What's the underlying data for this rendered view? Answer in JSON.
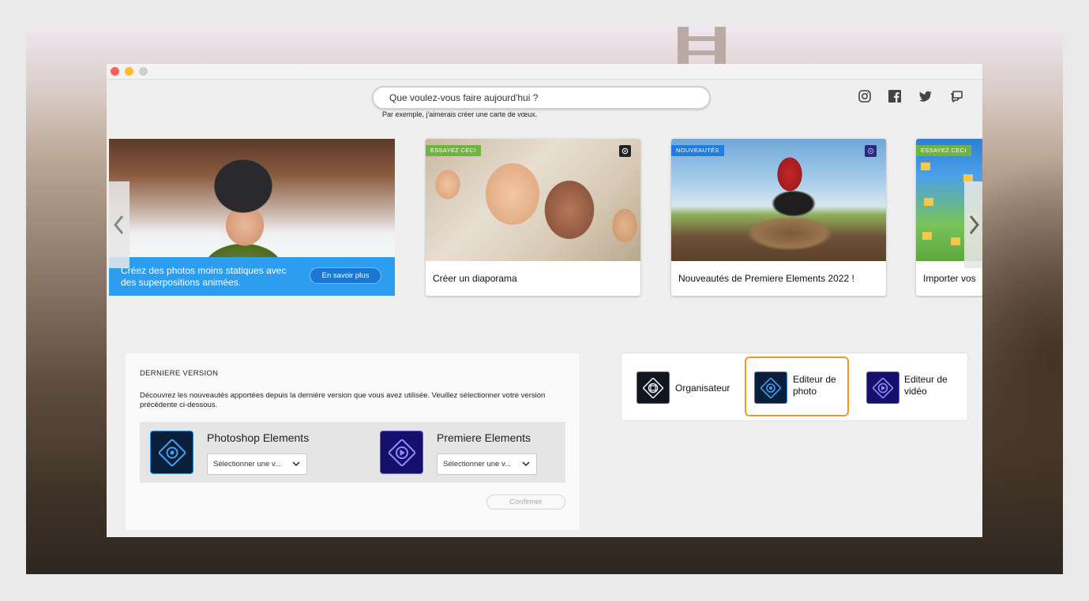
{
  "search": {
    "placeholder": "Que voulez-vous faire aujourd'hui ?",
    "hint": "Par exemple, j'aimerais créer une carte de vœux."
  },
  "social": [
    "instagram-icon",
    "facebook-icon",
    "twitter-icon",
    "chat-icon"
  ],
  "carousel": {
    "hero": {
      "text": "Créez des photos moins statiques avec des superpositions animées.",
      "button": "En savoir plus"
    },
    "cards": [
      {
        "tag": "ESSAYEZ CECI",
        "caption": "Créer un diaporama"
      },
      {
        "tag": "NOUVEAUTÉS",
        "caption": "Nouveautés de Premiere Elements 2022 !"
      },
      {
        "tag": "ESSAYEZ CECI",
        "caption": "Importer vos"
      }
    ]
  },
  "last_version": {
    "heading": "DERNIERE VERSION",
    "description": "Découvrez les nouveautés apportées depuis la dernière version que vous avez utilisée. Veuillez sélectionner votre version précédente ci-dessous.",
    "products": [
      {
        "name": "Photoshop Elements",
        "select": "Sélectionner une v..."
      },
      {
        "name": "Premiere Elements",
        "select": "Sélectionner une v..."
      }
    ],
    "confirm": "Confirmer"
  },
  "switcher": {
    "items": [
      {
        "label": "Organisateur"
      },
      {
        "label_line1": "Editeur de",
        "label_line2": "photo",
        "highlighted": true
      },
      {
        "label_line1": "Editeur de",
        "label_line2": "vidéo"
      }
    ]
  },
  "colors": {
    "accent_blue": "#2d9df0",
    "highlight_orange": "#f29a1f",
    "tag_green": "#6eb43f",
    "tag_blue": "#1d7de0"
  }
}
